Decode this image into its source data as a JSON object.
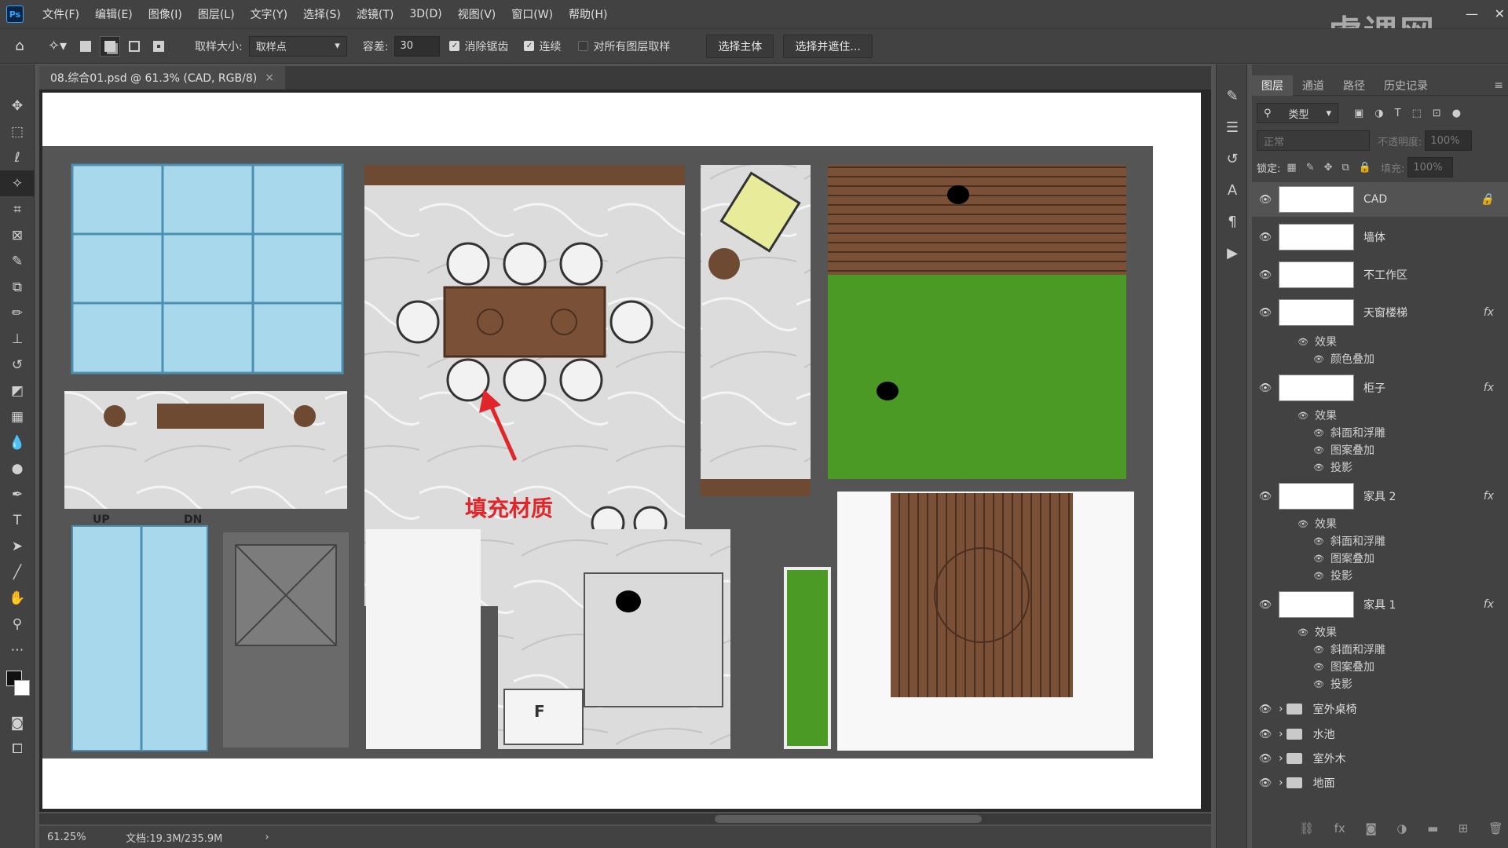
{
  "menubar": {
    "logo": "Ps",
    "items": [
      "文件(F)",
      "编辑(E)",
      "图像(I)",
      "图层(L)",
      "文字(Y)",
      "选择(S)",
      "滤镜(T)",
      "3D(D)",
      "视图(V)",
      "窗口(W)",
      "帮助(H)"
    ]
  },
  "watermark": "虎课网",
  "options": {
    "sample_size_label": "取样大小:",
    "sample_size_value": "取样点",
    "tolerance_label": "容差:",
    "tolerance_value": "30",
    "antialias_label": "消除锯齿",
    "contiguous_label": "连续",
    "all_layers_label": "对所有图层取样",
    "select_subject": "选择主体",
    "select_mask": "选择并遮住..."
  },
  "document": {
    "tab_title": "08.综合01.psd @ 61.3% (CAD, RGB/8)",
    "annotation": "填充材质",
    "stair_up": "UP",
    "stair_dn": "DN",
    "fridge_label": "F"
  },
  "status": {
    "zoom": "61.25%",
    "doc_size": "文档:19.3M/235.9M"
  },
  "panel": {
    "tabs": [
      "图层",
      "通道",
      "路径",
      "历史记录"
    ],
    "filter_label": "类型",
    "blend_mode": "正常",
    "opacity_label": "不透明度:",
    "opacity_value": "100%",
    "lock_label": "锁定:",
    "fill_label": "填充:",
    "fill_value": "100%",
    "layers": [
      {
        "name": "CAD",
        "fx": "",
        "locked": true
      },
      {
        "name": "墙体",
        "fx": ""
      },
      {
        "name": "不工作区",
        "fx": ""
      },
      {
        "name": "天窗楼梯",
        "fx": "fx",
        "effects_label": "效果",
        "effects": [
          "颜色叠加"
        ]
      },
      {
        "name": "柜子",
        "fx": "fx",
        "effects_label": "效果",
        "effects": [
          "斜面和浮雕",
          "图案叠加",
          "投影"
        ]
      },
      {
        "name": "家具 2",
        "fx": "fx",
        "effects_label": "效果",
        "effects": [
          "斜面和浮雕",
          "图案叠加",
          "投影"
        ]
      },
      {
        "name": "家具 1",
        "fx": "fx",
        "effects_label": "效果",
        "effects": [
          "斜面和浮雕",
          "图案叠加",
          "投影"
        ]
      }
    ],
    "groups": [
      "室外桌椅",
      "水池",
      "室外木",
      "地面"
    ]
  },
  "colors": {
    "ui_dark": "#424242",
    "canvas_bg": "#282828",
    "glass_blue": "#a8d8ec",
    "grass_green": "#4a9a25",
    "wood_brown": "#6e4a32",
    "annotation_red": "#e0262a",
    "selected_row": "#535353"
  }
}
